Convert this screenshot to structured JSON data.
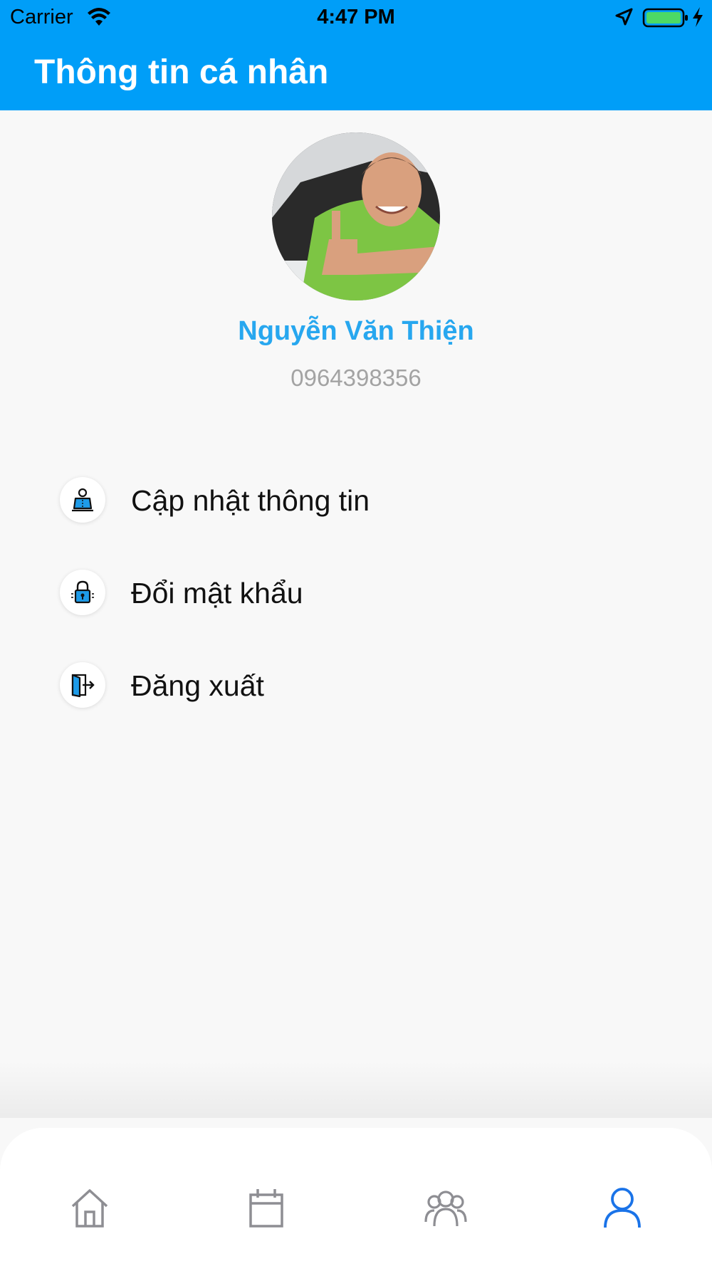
{
  "status_bar": {
    "carrier": "Carrier",
    "time": "4:47 PM"
  },
  "header": {
    "title": "Thông tin cá nhân",
    "background": "#009ef8"
  },
  "profile": {
    "avatar": "driver-photo",
    "name": "Nguyễn Văn Thiện",
    "phone": "0964398356",
    "name_color": "#27a7ef"
  },
  "menu": {
    "items": [
      {
        "label": "Cập nhật thông tin",
        "icon": "user-card-icon"
      },
      {
        "label": "Đổi mật khẩu",
        "icon": "lock-icon"
      },
      {
        "label": "Đăng xuất",
        "icon": "logout-door-icon"
      }
    ]
  },
  "tab_bar": {
    "tabs": [
      {
        "icon": "home-icon",
        "active": false
      },
      {
        "icon": "calendar-icon",
        "active": false
      },
      {
        "icon": "group-icon",
        "active": false
      },
      {
        "icon": "profile-icon",
        "active": true
      }
    ],
    "active_color": "#1a73e8",
    "inactive_color": "#8e8e93"
  }
}
